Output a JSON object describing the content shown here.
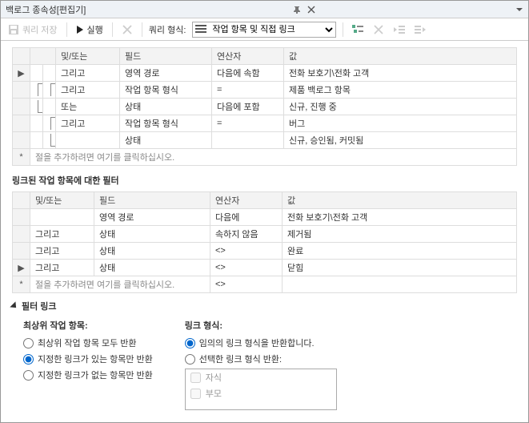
{
  "titlebar": {
    "title": "백로그 종속성[편집기]"
  },
  "toolbar": {
    "save": "쿼리 저장",
    "run": "실행",
    "format_label": "쿼리 형식:",
    "format_value": "작업 항목 및 직접 링크"
  },
  "grid1": {
    "headers": {
      "andor": "및/또는",
      "field": "필드",
      "operator": "연산자",
      "value": "값"
    },
    "rows": [
      {
        "mark": "▶",
        "g1": "",
        "g2": "",
        "andor": "그리고",
        "field": "영역 경로",
        "operator": "다음에 속함",
        "value": "전화 보호기\\전화 고객"
      },
      {
        "mark": "",
        "g1": "t",
        "g2": "t",
        "andor": "그리고",
        "field": "작업 항목 형식",
        "operator": "=",
        "value": "제품 백로그 항목"
      },
      {
        "mark": "",
        "g1": "b",
        "g2": "",
        "andor": "또는",
        "field": "상태",
        "operator": "다음에 포함",
        "value": "신규, 진행 중"
      },
      {
        "mark": "",
        "g1": "",
        "g2": "t",
        "andor": "그리고",
        "field": "작업 항목 형식",
        "operator": "=",
        "value": "버그"
      },
      {
        "mark": "",
        "g1": "",
        "g2": "b",
        "andor": "",
        "field": "상태",
        "operator": "",
        "value": "신규, 승인됨, 커밋됨"
      }
    ],
    "placeholder_mark": "*",
    "placeholder_text": "절을 추가하려면 여기를 클릭하십시오."
  },
  "section2_title": "링크된 작업 항목에 대한 필터",
  "grid2": {
    "headers": {
      "andor": "및/또는",
      "field": "필드",
      "operator": "연산자",
      "value": "값"
    },
    "rows": [
      {
        "mark": "",
        "andor": "",
        "field": "영역 경로",
        "operator": "다음에",
        "value": "전화 보호기\\전화 고객"
      },
      {
        "mark": "",
        "andor": "그리고",
        "field": "상태",
        "operator": "속하지 않음",
        "value": "제거됨"
      },
      {
        "mark": "",
        "andor": "그리고",
        "field": "상태",
        "operator": "<>",
        "value": "완료"
      },
      {
        "mark": "▶",
        "andor": "그리고",
        "field": "상태",
        "operator": "<>",
        "value": "닫힘"
      }
    ],
    "placeholder_mark": "*",
    "placeholder_text": "절을 추가하려면 여기를 클릭하십시오.",
    "placeholder_op": "<>"
  },
  "filterlink": {
    "title": "필터 링크",
    "left_title": "최상위 작업 항목:",
    "left_options": [
      "최상위 작업 항목 모두 반환",
      "지정한 링크가 있는 항목만 반환",
      "지정한 링크가 없는 항목만 반환"
    ],
    "left_selected": 1,
    "right_title": "링크 형식:",
    "right_options": [
      "임의의 링크 형식을 반환합니다.",
      "선택한 링크 형식 반환:"
    ],
    "right_selected": 0,
    "link_types": [
      "자식",
      "부모"
    ]
  }
}
